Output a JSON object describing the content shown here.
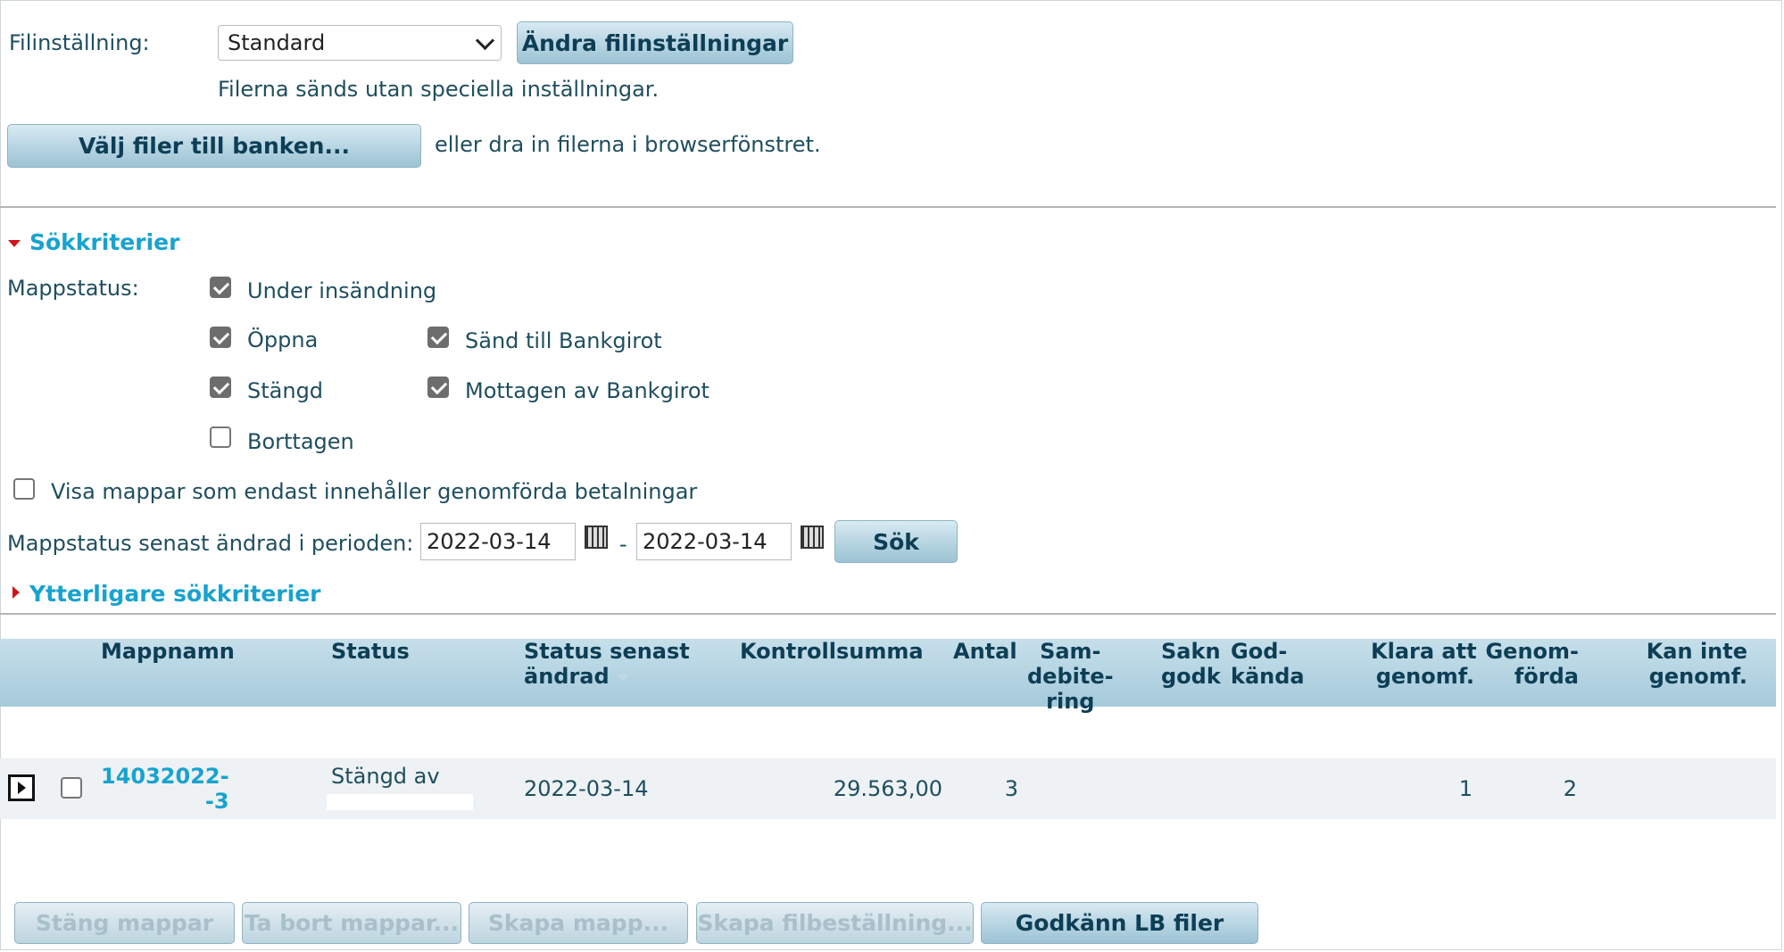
{
  "file_settings": {
    "label": "Filinställning:",
    "selected": "Standard",
    "change_button": "Ändra filinställningar",
    "description": "Filerna sänds utan speciella inställningar."
  },
  "upload": {
    "choose_button": "Välj filer till banken...",
    "drag_hint": "eller dra in filerna i browserfönstret."
  },
  "search": {
    "section_title": "Sökkriterier",
    "folder_status_label": "Mappstatus:",
    "statuses": {
      "under_sending": {
        "label": "Under insändning",
        "checked": true
      },
      "open": {
        "label": "Öppna",
        "checked": true
      },
      "sent_bankgirot": {
        "label": "Sänd till Bankgirot",
        "checked": true
      },
      "closed": {
        "label": "Stängd",
        "checked": true
      },
      "received_bankgirot": {
        "label": "Mottagen av Bankgirot",
        "checked": true
      },
      "deleted": {
        "label": "Borttagen",
        "checked": false
      }
    },
    "only_completed": {
      "label": "Visa mappar som endast innehåller genomförda betalningar",
      "checked": false
    },
    "period_label": "Mappstatus senast ändrad i perioden:",
    "date_from": "2022-03-14",
    "date_separator": "-",
    "date_to": "2022-03-14",
    "search_button": "Sök",
    "more_criteria": "Ytterligare sökkriterier"
  },
  "table": {
    "headers": {
      "folder_name": "Mappnamn",
      "status": "Status",
      "status_changed_1": "Status senast",
      "status_changed_2": "ändrad",
      "checksum": "Kontrollsumma",
      "count": "Antal",
      "co_debit_1": "Sam-",
      "co_debit_2": "debite-",
      "co_debit_3": "ring",
      "missing_1": "Sakn",
      "missing_2": "godk",
      "approved_1": "God-",
      "approved_2": "kända",
      "ready_1": "Klara att",
      "ready_2": "genomf.",
      "completed_1": "Genom-",
      "completed_2": "förda",
      "failed_1": "Kan inte",
      "failed_2": "genomf."
    },
    "rows": [
      {
        "folder_name_1": "14032022-",
        "folder_name_2": "-3",
        "status": "Stängd av",
        "status_changed": "2022-03-14",
        "checksum": "29.563,00",
        "count": "3",
        "ready": "1",
        "completed": "2",
        "selected": false
      }
    ]
  },
  "actions": {
    "close_folders": "Stäng mappar",
    "delete_folders": "Ta bort mappar...",
    "create_folder": "Skapa mapp...",
    "create_file_order": "Skapa filbeställning...",
    "approve_lb": "Godkänn LB filer"
  },
  "colors": {
    "link": "#18a2cf",
    "text": "#1f4e5f",
    "header_bg": "#a6cadb",
    "arrow": "#d0151a"
  }
}
